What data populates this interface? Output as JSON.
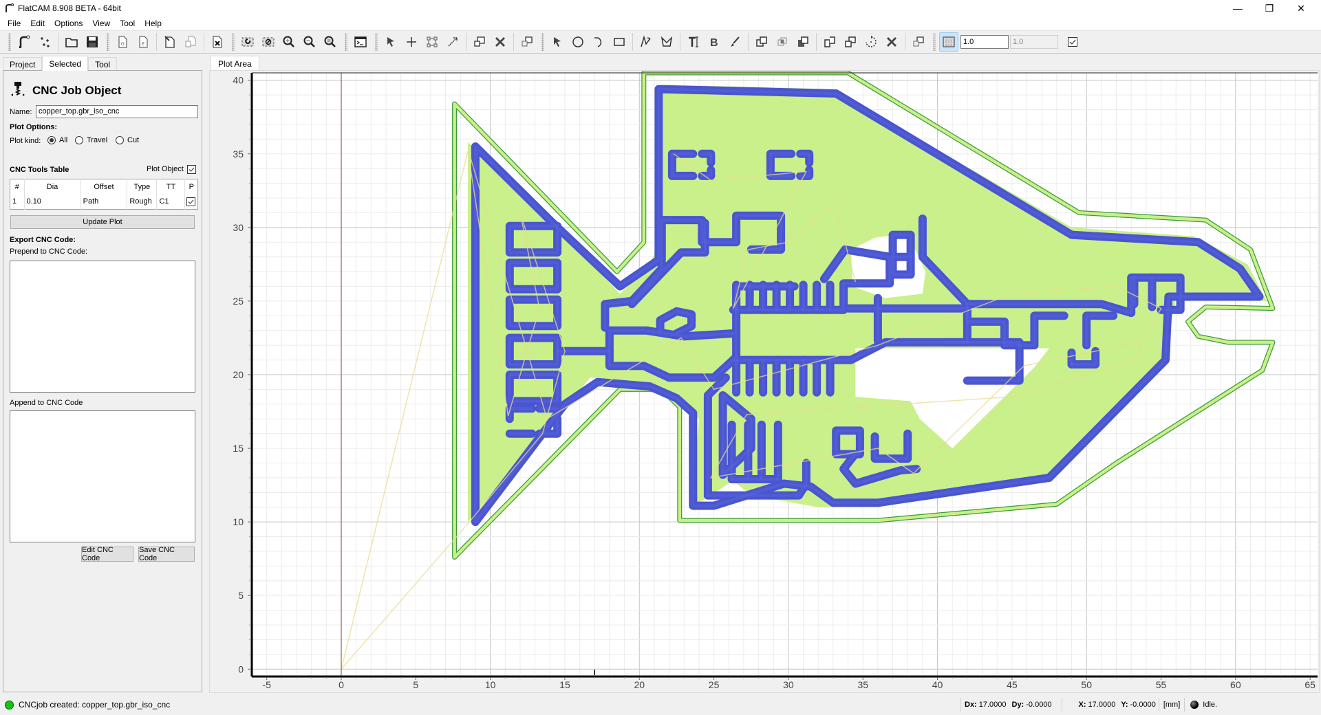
{
  "window": {
    "title": "FlatCAM 8.908 BETA - 64bit",
    "controls": {
      "minimize": "—",
      "restore": "❐",
      "close": "✕"
    }
  },
  "menu": [
    "File",
    "Edit",
    "Options",
    "View",
    "Tool",
    "Help"
  ],
  "toolbar": {
    "icons": [
      "open-gerber-icon",
      "open-excellon-icon",
      "open-folder-icon",
      "save-icon",
      "new-geometry-icon",
      "new-excellon-icon",
      "edit-icon",
      "copy-icon",
      "delete-icon",
      "replot-icon",
      "clear-plot-icon",
      "zoom-in-icon",
      "zoom-out-icon",
      "zoom-fit-icon",
      "shell-icon",
      "select-icon",
      "add-drill-icon",
      "add-drill-array-icon",
      "resize-drill-icon",
      "copy-drill-icon",
      "delete-drill-icon",
      "move-drill-icon",
      "select-geo-icon",
      "circle-icon",
      "arc-icon",
      "rectangle-icon",
      "path-icon",
      "polygon-icon",
      "text-icon",
      "buffer-icon",
      "paint-icon",
      "union-icon",
      "intersection-icon",
      "subtraction-icon",
      "cut-path-icon",
      "copy-shape-icon",
      "rotate-icon",
      "delete-shape-icon",
      "move-shape-icon",
      "grid-snap-icon"
    ],
    "grid_x": "1.0",
    "grid_y": "1.0",
    "grid_lock_checked": true
  },
  "left_panel": {
    "tabs": [
      "Project",
      "Selected",
      "Tool"
    ],
    "active_tab": "Selected",
    "header": "CNC Job Object",
    "name_label": "Name:",
    "name_value": "copper_top.gbr_iso_cnc",
    "plot_options_label": "Plot Options:",
    "plot_kind_label": "Plot kind:",
    "plot_kind_options": [
      "All",
      "Travel",
      "Cut"
    ],
    "plot_kind_selected": "All",
    "tools_table_label": "CNC Tools Table",
    "plot_object_label": "Plot Object",
    "plot_object_checked": true,
    "tools_table": {
      "headers": [
        "#",
        "Dia",
        "Offset",
        "Type",
        "TT",
        "P"
      ],
      "rows": [
        {
          "num": "1",
          "dia": "0.10",
          "offset": "Path",
          "type": "Rough",
          "tt": "C1",
          "p": true
        }
      ]
    },
    "update_plot_button": "Update Plot",
    "export_label": "Export CNC Code:",
    "prepend_label": "Prepend to CNC Code:",
    "prepend_value": "",
    "append_label": "Append to CNC Code",
    "append_value": "",
    "edit_button": "Edit CNC Code",
    "save_button": "Save CNC Code"
  },
  "plot": {
    "tab_label": "Plot Area",
    "x_ticks": [
      "-5",
      "0",
      "5",
      "10",
      "15",
      "20",
      "25",
      "30",
      "35",
      "40",
      "45",
      "50",
      "55",
      "60",
      "65"
    ],
    "y_ticks": [
      "0",
      "5",
      "10",
      "15",
      "20",
      "25",
      "30",
      "35",
      "40"
    ],
    "x_range": [
      -6,
      65.5
    ],
    "y_range": [
      -0.5,
      40.5
    ],
    "colors": {
      "copper_fill": "#c9f08a",
      "toolpath": "#4a55d0",
      "outline": "#3c9a3c",
      "travel": "#e8dc8e",
      "axis_line": "#8b3a3a"
    },
    "cursor_x": 17
  },
  "status": {
    "message": "CNCjob created: copper_top.gbr_iso_cnc",
    "dx_label": "Dx:",
    "dx": "17.0000",
    "dy_label": "Dy:",
    "dy": "-0.0000",
    "x_label": "X:",
    "x": "17.0000",
    "y_label": "Y:",
    "y": "-0.0000",
    "units": "[mm]",
    "state": "Idle."
  }
}
